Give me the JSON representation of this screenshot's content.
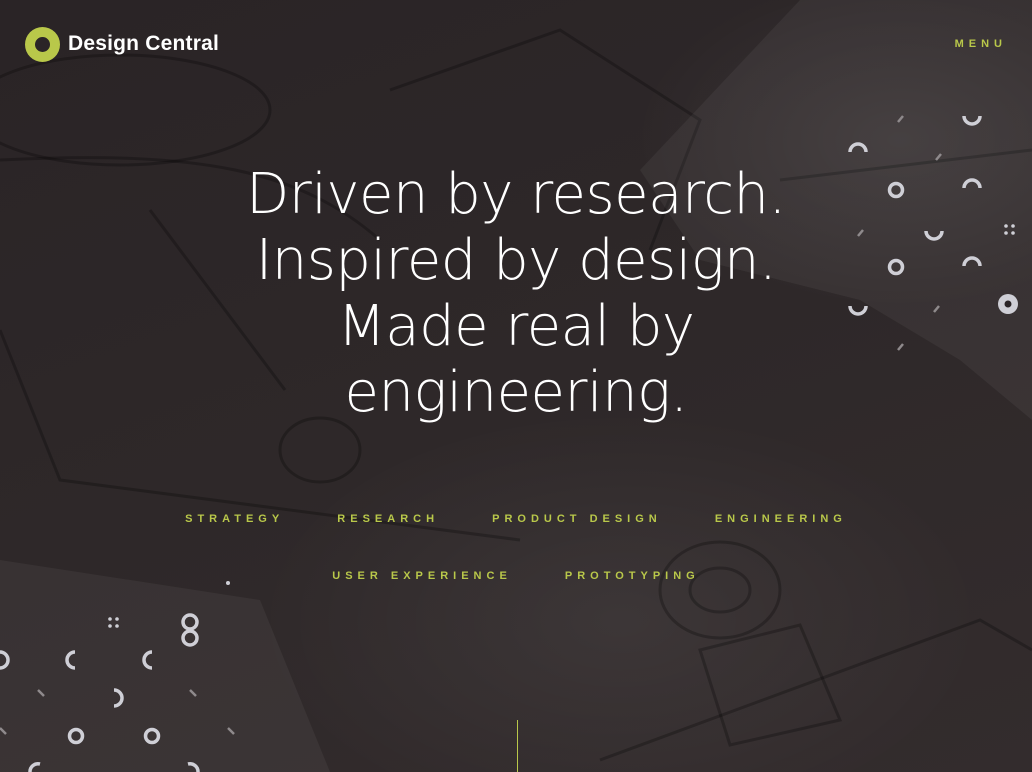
{
  "brand": {
    "name": "Design Central"
  },
  "nav": {
    "menu_label": "MENU"
  },
  "hero": {
    "lines": [
      "Driven by research.",
      "Inspired by design.",
      "Made real by",
      "engineering."
    ]
  },
  "services": {
    "row1": [
      "STRATEGY",
      "RESEARCH",
      "PRODUCT DESIGN",
      "ENGINEERING"
    ],
    "row2": [
      "USER EXPERIENCE",
      "PROTOTYPING"
    ]
  },
  "colors": {
    "accent": "#b9c84a",
    "background": "#2b2527",
    "text": "#ffffff"
  },
  "icons": {
    "logo": "ring-logo-icon",
    "decor": "geometric-pattern-icon",
    "scroll": "scroll-indicator-line"
  }
}
